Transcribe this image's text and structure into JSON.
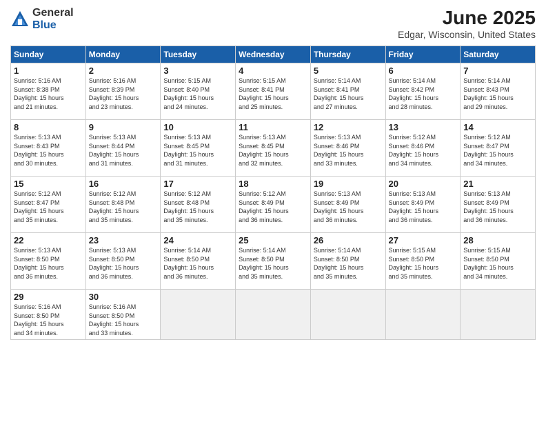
{
  "logo": {
    "general": "General",
    "blue": "Blue"
  },
  "title": "June 2025",
  "subtitle": "Edgar, Wisconsin, United States",
  "days_header": [
    "Sunday",
    "Monday",
    "Tuesday",
    "Wednesday",
    "Thursday",
    "Friday",
    "Saturday"
  ],
  "weeks": [
    [
      {
        "num": "1",
        "info": "Sunrise: 5:16 AM\nSunset: 8:38 PM\nDaylight: 15 hours\nand 21 minutes."
      },
      {
        "num": "2",
        "info": "Sunrise: 5:16 AM\nSunset: 8:39 PM\nDaylight: 15 hours\nand 23 minutes."
      },
      {
        "num": "3",
        "info": "Sunrise: 5:15 AM\nSunset: 8:40 PM\nDaylight: 15 hours\nand 24 minutes."
      },
      {
        "num": "4",
        "info": "Sunrise: 5:15 AM\nSunset: 8:41 PM\nDaylight: 15 hours\nand 25 minutes."
      },
      {
        "num": "5",
        "info": "Sunrise: 5:14 AM\nSunset: 8:41 PM\nDaylight: 15 hours\nand 27 minutes."
      },
      {
        "num": "6",
        "info": "Sunrise: 5:14 AM\nSunset: 8:42 PM\nDaylight: 15 hours\nand 28 minutes."
      },
      {
        "num": "7",
        "info": "Sunrise: 5:14 AM\nSunset: 8:43 PM\nDaylight: 15 hours\nand 29 minutes."
      }
    ],
    [
      {
        "num": "8",
        "info": "Sunrise: 5:13 AM\nSunset: 8:43 PM\nDaylight: 15 hours\nand 30 minutes."
      },
      {
        "num": "9",
        "info": "Sunrise: 5:13 AM\nSunset: 8:44 PM\nDaylight: 15 hours\nand 31 minutes."
      },
      {
        "num": "10",
        "info": "Sunrise: 5:13 AM\nSunset: 8:45 PM\nDaylight: 15 hours\nand 31 minutes."
      },
      {
        "num": "11",
        "info": "Sunrise: 5:13 AM\nSunset: 8:45 PM\nDaylight: 15 hours\nand 32 minutes."
      },
      {
        "num": "12",
        "info": "Sunrise: 5:13 AM\nSunset: 8:46 PM\nDaylight: 15 hours\nand 33 minutes."
      },
      {
        "num": "13",
        "info": "Sunrise: 5:12 AM\nSunset: 8:46 PM\nDaylight: 15 hours\nand 34 minutes."
      },
      {
        "num": "14",
        "info": "Sunrise: 5:12 AM\nSunset: 8:47 PM\nDaylight: 15 hours\nand 34 minutes."
      }
    ],
    [
      {
        "num": "15",
        "info": "Sunrise: 5:12 AM\nSunset: 8:47 PM\nDaylight: 15 hours\nand 35 minutes."
      },
      {
        "num": "16",
        "info": "Sunrise: 5:12 AM\nSunset: 8:48 PM\nDaylight: 15 hours\nand 35 minutes."
      },
      {
        "num": "17",
        "info": "Sunrise: 5:12 AM\nSunset: 8:48 PM\nDaylight: 15 hours\nand 35 minutes."
      },
      {
        "num": "18",
        "info": "Sunrise: 5:12 AM\nSunset: 8:49 PM\nDaylight: 15 hours\nand 36 minutes."
      },
      {
        "num": "19",
        "info": "Sunrise: 5:13 AM\nSunset: 8:49 PM\nDaylight: 15 hours\nand 36 minutes."
      },
      {
        "num": "20",
        "info": "Sunrise: 5:13 AM\nSunset: 8:49 PM\nDaylight: 15 hours\nand 36 minutes."
      },
      {
        "num": "21",
        "info": "Sunrise: 5:13 AM\nSunset: 8:49 PM\nDaylight: 15 hours\nand 36 minutes."
      }
    ],
    [
      {
        "num": "22",
        "info": "Sunrise: 5:13 AM\nSunset: 8:50 PM\nDaylight: 15 hours\nand 36 minutes."
      },
      {
        "num": "23",
        "info": "Sunrise: 5:13 AM\nSunset: 8:50 PM\nDaylight: 15 hours\nand 36 minutes."
      },
      {
        "num": "24",
        "info": "Sunrise: 5:14 AM\nSunset: 8:50 PM\nDaylight: 15 hours\nand 36 minutes."
      },
      {
        "num": "25",
        "info": "Sunrise: 5:14 AM\nSunset: 8:50 PM\nDaylight: 15 hours\nand 35 minutes."
      },
      {
        "num": "26",
        "info": "Sunrise: 5:14 AM\nSunset: 8:50 PM\nDaylight: 15 hours\nand 35 minutes."
      },
      {
        "num": "27",
        "info": "Sunrise: 5:15 AM\nSunset: 8:50 PM\nDaylight: 15 hours\nand 35 minutes."
      },
      {
        "num": "28",
        "info": "Sunrise: 5:15 AM\nSunset: 8:50 PM\nDaylight: 15 hours\nand 34 minutes."
      }
    ],
    [
      {
        "num": "29",
        "info": "Sunrise: 5:16 AM\nSunset: 8:50 PM\nDaylight: 15 hours\nand 34 minutes."
      },
      {
        "num": "30",
        "info": "Sunrise: 5:16 AM\nSunset: 8:50 PM\nDaylight: 15 hours\nand 33 minutes."
      },
      {
        "num": "",
        "info": ""
      },
      {
        "num": "",
        "info": ""
      },
      {
        "num": "",
        "info": ""
      },
      {
        "num": "",
        "info": ""
      },
      {
        "num": "",
        "info": ""
      }
    ]
  ]
}
